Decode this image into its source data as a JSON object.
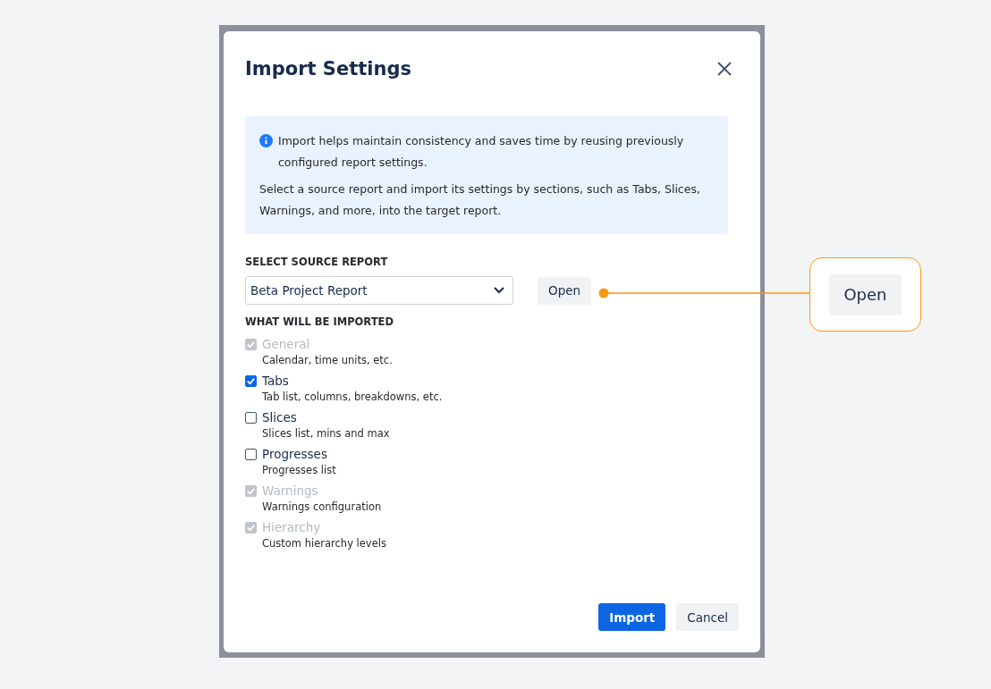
{
  "dialog": {
    "title": "Import Settings",
    "info": [
      "Import helps maintain consistency and saves time by reusing previously configured report settings.",
      "Select a source report and import its settings by sections, such as Tabs, Slices, Warnings, and more, into the target report."
    ],
    "source_label": "SELECT SOURCE REPORT",
    "source_value": "Beta Project Report",
    "open_button": "Open",
    "imported_label": "WHAT WILL BE IMPORTED",
    "items": [
      {
        "label": "General",
        "description": "Calendar, time units, etc.",
        "checked": true,
        "disabled": true
      },
      {
        "label": "Tabs",
        "description": "Tab list, columns, breakdowns, etc.",
        "checked": true,
        "disabled": false
      },
      {
        "label": "Slices",
        "description": "Slices list, mins and max",
        "checked": false,
        "disabled": false
      },
      {
        "label": "Progresses",
        "description": "Progresses list",
        "checked": false,
        "disabled": false
      },
      {
        "label": "Warnings",
        "description": "Warnings configuration",
        "checked": true,
        "disabled": true
      },
      {
        "label": "Hierarchy",
        "description": "Custom hierarchy levels",
        "checked": true,
        "disabled": true
      }
    ],
    "buttons": [
      {
        "label": "Import",
        "kind": "primary"
      },
      {
        "label": "Cancel",
        "kind": "secondary"
      }
    ]
  },
  "callout": {
    "button": "Open"
  }
}
